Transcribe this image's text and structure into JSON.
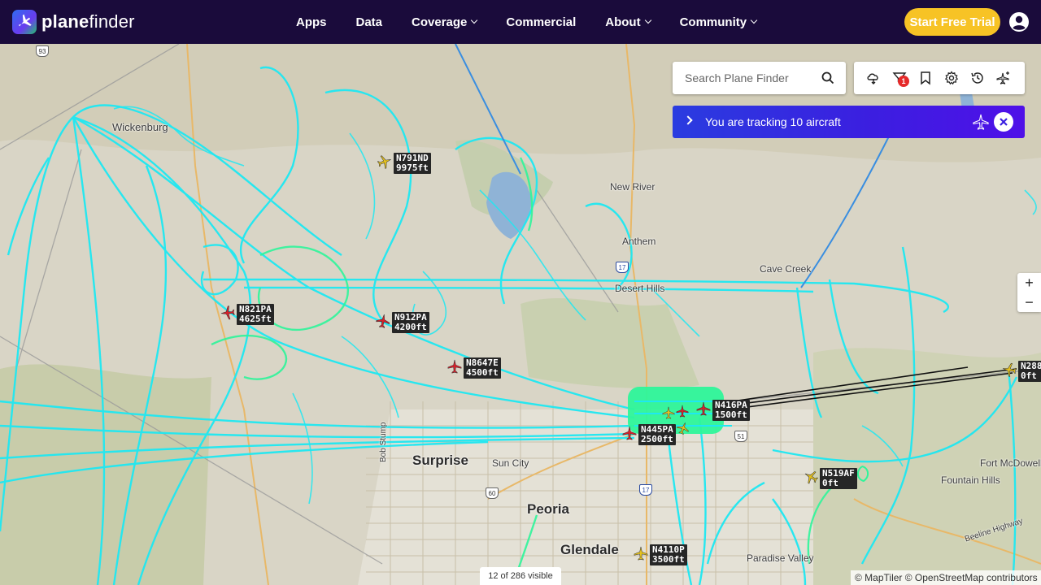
{
  "nav": {
    "logo_text_bold": "plane",
    "logo_text": "finder",
    "links": [
      {
        "label": "Apps",
        "dropdown": false
      },
      {
        "label": "Data",
        "dropdown": false
      },
      {
        "label": "Coverage",
        "dropdown": true
      },
      {
        "label": "Commercial",
        "dropdown": false
      },
      {
        "label": "About",
        "dropdown": true
      },
      {
        "label": "Community",
        "dropdown": true
      }
    ],
    "trial_label": "Start Free Trial",
    "user_icon": "user-circle-icon"
  },
  "search": {
    "placeholder": "Search Plane Finder",
    "icon": "search-icon"
  },
  "toolbar": {
    "buttons": [
      "weather-icon",
      "filter-icon",
      "bookmark-icon",
      "settings-icon",
      "history-icon",
      "add-plane-icon"
    ],
    "filter_badge": "1"
  },
  "tracking": {
    "text": "You are tracking 10 aircraft",
    "icon": "plane-icon",
    "close_icon": "close-icon"
  },
  "zoom": {
    "in": "+",
    "out": "−"
  },
  "visible_count": "12 of 286 visible",
  "attribution": "© MapTiler © OpenStreetMap contributors",
  "colors": {
    "nav_bg": "#1a0b3b",
    "trial_btn": "#f7c325",
    "track_trail": "#1ee8f2",
    "track_trail_alt": "#2ef59a",
    "plane_red": "#d8202a",
    "plane_yellow": "#e6c21d"
  },
  "places": {
    "wickenburg": "Wickenburg",
    "new_river": "New River",
    "anthem": "Anthem",
    "cave_creek": "Cave Creek",
    "desert_hills": "Desert Hills",
    "surprise": "Surprise",
    "sun_city": "Sun City",
    "peoria": "Peoria",
    "glendale": "Glendale",
    "paradise_valley": "Paradise Valley",
    "fountain_hills": "Fountain Hills",
    "fort_mcdowell": "Fort McDowell",
    "bob_stump": "Bob Stump",
    "beeline": "Beeline Highway",
    "rt93": "93",
    "rt17": "17",
    "rt51": "51",
    "rt60": "60",
    "rt17b": "17"
  },
  "aircraft": [
    {
      "callsign": "N791ND",
      "alt": "9975ft"
    },
    {
      "callsign": "N821PA",
      "alt": "4625ft"
    },
    {
      "callsign": "N912PA",
      "alt": "4200ft"
    },
    {
      "callsign": "N8647E",
      "alt": "4500ft"
    },
    {
      "callsign": "N416PA",
      "alt": "1500ft"
    },
    {
      "callsign": "N445PA",
      "alt": "2500ft"
    },
    {
      "callsign": "N288",
      "alt": "0ft"
    },
    {
      "callsign": "N519AF",
      "alt": "0ft"
    },
    {
      "callsign": "N4110P",
      "alt": "3500ft"
    }
  ]
}
